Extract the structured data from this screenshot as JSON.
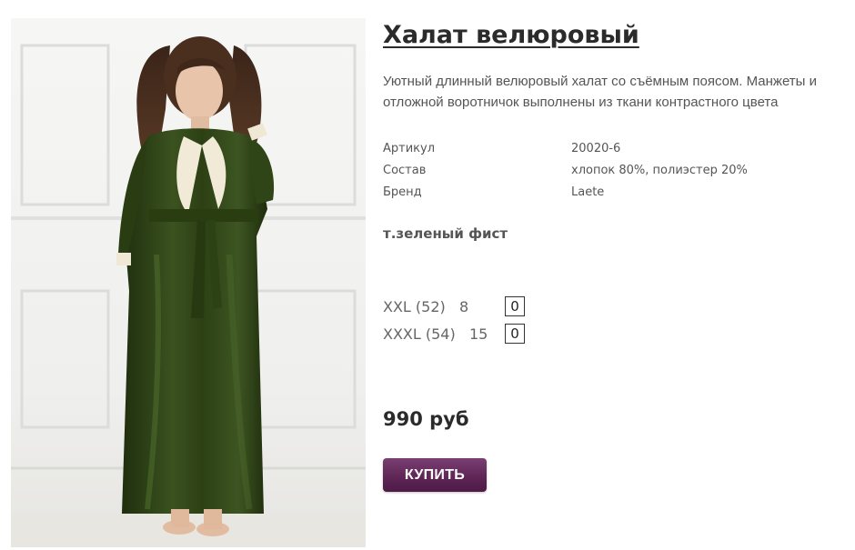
{
  "product": {
    "title": "Халат велюровый",
    "description": "Уютный длинный велюровый халат со съёмным поясом. Манжеты и отложной воротничок выполнены из ткани контрастного цвета",
    "specs": [
      {
        "label": "Артикул",
        "value": "20020-6"
      },
      {
        "label": "Состав",
        "value": "хлопок 80%, полиэстер 20%"
      },
      {
        "label": "Бренд",
        "value": "Laete"
      }
    ],
    "color": "т.зеленый фист",
    "sizes": [
      {
        "label": "XXL (52)   8",
        "qty": "0"
      },
      {
        "label": "XXXL (54)   15",
        "qty": "0"
      }
    ],
    "price": "990 руб",
    "buy_label": "КУПИТЬ"
  },
  "colors": {
    "title": "#2b2b2b",
    "text": "#555555",
    "button": "#5f2656",
    "robe": "#2f4317"
  }
}
